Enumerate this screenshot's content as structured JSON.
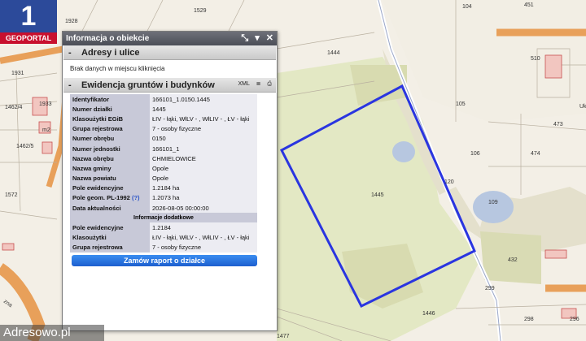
{
  "logo": {
    "number": "1",
    "text": "GEOPORTAL"
  },
  "panel": {
    "title": "Informacja o obiekcie",
    "controls": [
      "⤡",
      "▾",
      "✕"
    ],
    "sections": {
      "addresses": {
        "toggle": "-",
        "title": "Adresy i ulice",
        "message": "Brak danych w miejscu kliknięcia"
      },
      "registry": {
        "toggle": "-",
        "title": "Ewidencja gruntów i budynków",
        "tools": [
          "XML",
          "≣",
          "⎙"
        ]
      }
    },
    "attributes": [
      {
        "key": "Identyfikator",
        "value": "166101_1.0150.1445"
      },
      {
        "key": "Numer działki",
        "value": "1445"
      },
      {
        "key": "Klasoużytki EGiB",
        "value": "ŁIV - łąki, WłLV - , WłLIV - , ŁV - łąki"
      },
      {
        "key": "Grupa rejestrowa",
        "value": "7 - osoby fizyczne"
      },
      {
        "key": "Numer obrębu",
        "value": "0150"
      },
      {
        "key": "Numer jednostki",
        "value": "166101_1"
      },
      {
        "key": "Nazwa obrębu",
        "value": "CHMIELOWICE"
      },
      {
        "key": "Nazwa gminy",
        "value": "Opole"
      },
      {
        "key": "Nazwa powiatu",
        "value": "Opole"
      },
      {
        "key": "Pole ewidencyjne",
        "value": "1.2184 ha"
      },
      {
        "key": "Pole geom. PL-1992",
        "help": "(?)",
        "value": "1.2073 ha"
      },
      {
        "key": "Data aktualności",
        "value": "2026-08-05 00:00:00"
      }
    ],
    "additional_title": "Informacje dodatkowe",
    "additional": [
      {
        "key": "Pole ewidencyjne",
        "value": "1.2184"
      },
      {
        "key": "Klasoużytki",
        "value": "ŁIV - łąki, WłLV - , WłLIV - , ŁV - łąki"
      },
      {
        "key": "Grupa rejestrowa",
        "value": "7 - osoby fizyczne"
      }
    ],
    "report_button": "Zamów raport o działce"
  },
  "map": {
    "parcel_labels": [
      "1529",
      "1928",
      "1931",
      "1933",
      "1462/4",
      "1462/5",
      "1572",
      "1444",
      "1445",
      "1446",
      "1477",
      "105",
      "104",
      "106",
      "109",
      "120",
      "432",
      "473",
      "474",
      "299",
      "298",
      "296",
      "510",
      "451",
      "m2",
      "Uk"
    ],
    "road_label": "zna",
    "highlight_color": "#2a35e0"
  },
  "watermark": "Adresowo.pl"
}
